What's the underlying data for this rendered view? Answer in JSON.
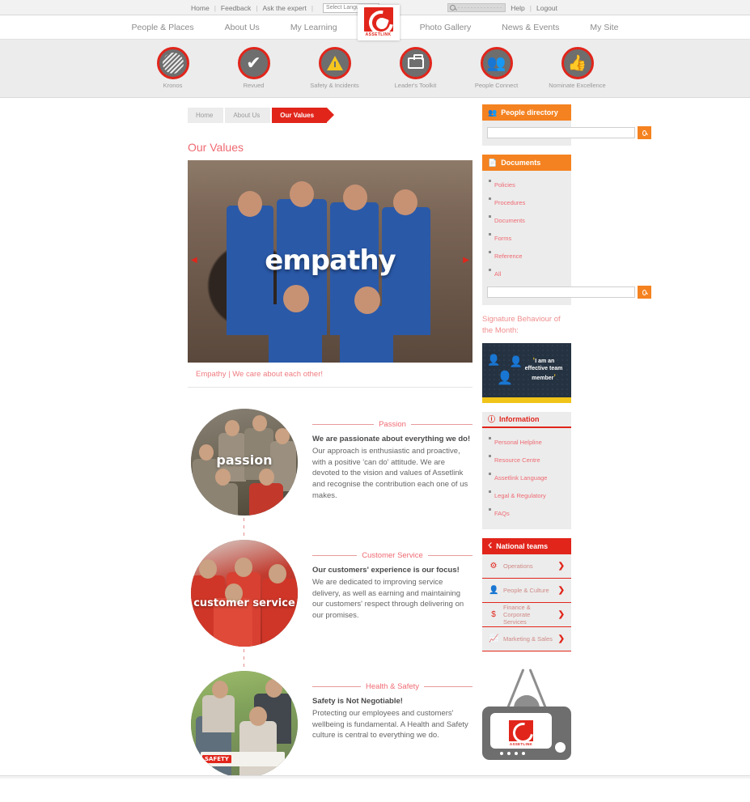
{
  "topbar": {
    "links": [
      {
        "label": "Home"
      },
      {
        "label": "Feedback"
      },
      {
        "label": "Ask the expert"
      }
    ],
    "separator": "|",
    "language_select": "Select Language",
    "language_caret": "▼",
    "search_placeholder": "",
    "search_value": "",
    "help_label": "Help",
    "logout_label": "Logout"
  },
  "nav": {
    "left_items": [
      {
        "label": "People & Places"
      },
      {
        "label": "About Us"
      },
      {
        "label": "My Learning"
      }
    ],
    "right_items": [
      {
        "label": "Photo Gallery"
      },
      {
        "label": "News & Events"
      },
      {
        "label": "My Site"
      }
    ],
    "logo_text": "ASSETLINK"
  },
  "quicklinks": [
    {
      "label": "Kronos",
      "icon": "kronos-icon"
    },
    {
      "label": "Revued",
      "icon": "check-icon"
    },
    {
      "label": "Safety & Incidents",
      "icon": "warning-triangle-icon"
    },
    {
      "label": "Leader's Toolkit",
      "icon": "briefcase-icon"
    },
    {
      "label": "People Connect",
      "icon": "people-icon"
    },
    {
      "label": "Nominate Excellence",
      "icon": "thumbs-up-icon"
    }
  ],
  "breadcrumb": [
    {
      "label": "Home",
      "active": false
    },
    {
      "label": "About Us",
      "active": false
    },
    {
      "label": "Our Values",
      "active": true
    }
  ],
  "main": {
    "page_title": "Our Values",
    "banner": {
      "word": "empathy",
      "caption": "Empathy | We care about each other!",
      "prev_arrow": "◀",
      "next_arrow": "▶"
    },
    "values": [
      {
        "name": "Passion",
        "photo_word": "passion",
        "lead": "We are passionate about everything we do!",
        "body": "Our approach is enthusiastic and proactive, with a positive 'can do' attitude.\nWe are devoted to the vision and values of Assetlink and recognise the contribution each one of us makes."
      },
      {
        "name": "Customer Service",
        "photo_word": "customer service",
        "lead": "Our customers' experience is our focus!",
        "body": "We are dedicated to improving service delivery, as well as earning and maintaining our customers' respect through delivering on our promises."
      },
      {
        "name": "Health & Safety",
        "photo_word": "SAFETY",
        "lead": "Safety is Not Negotiable!",
        "body": "Protecting our employees and customers' wellbeing is fundamental. A Health and Safety culture is central to everything we do."
      }
    ]
  },
  "sidebar": {
    "people_directory": {
      "title": "People directory",
      "icon": "people-directory-icon",
      "search_value": "",
      "search_button_icon": "search-icon"
    },
    "documents": {
      "title": "Documents",
      "icon": "documents-icon",
      "links": [
        {
          "label": "Policies"
        },
        {
          "label": "Procedures"
        },
        {
          "label": "Documents"
        },
        {
          "label": "Forms"
        },
        {
          "label": "Reference"
        },
        {
          "label": "All"
        }
      ],
      "search_value": "",
      "search_button_icon": "search-icon"
    },
    "signature_behaviour": {
      "title": "Signature Behaviour of the Month:",
      "quote_open": "‘",
      "quote_text": "I am an effective team member",
      "quote_close": "’"
    },
    "information": {
      "title": "Information",
      "icon": "info-icon",
      "links": [
        {
          "label": "Personal Helpline"
        },
        {
          "label": "Resource Centre"
        },
        {
          "label": "Assetlink Language"
        },
        {
          "label": "Legal & Regulatory"
        },
        {
          "label": "FAQs"
        }
      ]
    },
    "national_teams": {
      "title": "National teams",
      "icon": "network-icon",
      "items": [
        {
          "label": "Operations",
          "icon": "gear-icon",
          "chevron": "❯"
        },
        {
          "label": "People & Culture",
          "icon": "person-icon",
          "chevron": "❯"
        },
        {
          "label": "Finance & Corporate Services",
          "icon": "dollar-icon",
          "chevron": "❯"
        },
        {
          "label": "Marketing & Sales",
          "icon": "bar-chart-icon",
          "chevron": "❯"
        }
      ]
    },
    "tv_widget": {
      "icon": "retro-tv-icon",
      "screen_label": "ASSETLINK"
    }
  },
  "colors": {
    "brand_red": "#e1251b",
    "accent_orange": "#f58220",
    "link_pink": "#ef6a72",
    "panel_grey": "#ececec",
    "signature_yellow": "#f0c419"
  }
}
